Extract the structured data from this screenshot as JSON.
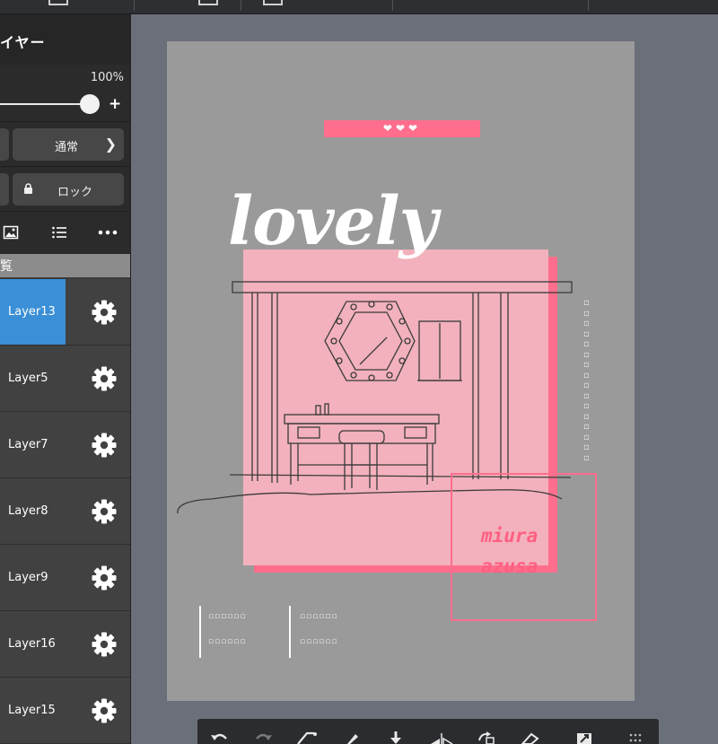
{
  "panel": {
    "title": "イヤー",
    "opacity": "100%",
    "plus": "+",
    "blend_mode": "通常",
    "lock_label": "ロック",
    "list_header": "覧",
    "layers": [
      {
        "name": "Layer13",
        "selected": true
      },
      {
        "name": "Layer5",
        "selected": false
      },
      {
        "name": "Layer7",
        "selected": false
      },
      {
        "name": "Layer8",
        "selected": false
      },
      {
        "name": "Layer9",
        "selected": false
      },
      {
        "name": "Layer16",
        "selected": false
      },
      {
        "name": "Layer15",
        "selected": false
      }
    ]
  },
  "canvas": {
    "hearts": "❤❤❤",
    "title": "lovely",
    "side_text": "▫▫▫▫▫▫▫▫▫▫▫▫▫▫▫▫",
    "name_line1": "miura",
    "name_line2": "azusa",
    "credits_left_1": "▫▫▫▫▫▫",
    "credits_left_2": "▫▫▫▫▫▫",
    "credits_right_1": "▫▫▫▫▫▫",
    "credits_right_2": "▫▫▫▫▫▫"
  },
  "colors": {
    "accent_pink": "#ff6e8d",
    "soft_pink": "#f2b1bc",
    "selected_layer": "#3a8fd6"
  }
}
